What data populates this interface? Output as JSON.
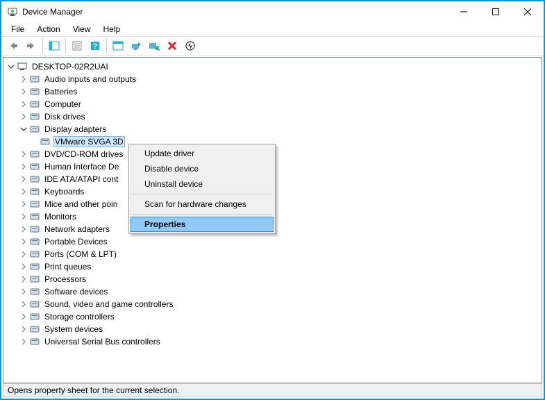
{
  "window": {
    "title": "Device Manager"
  },
  "menubar": {
    "file": "File",
    "action": "Action",
    "view": "View",
    "help": "Help"
  },
  "toolbar_icons": {
    "back": "back-arrow",
    "forward": "forward-arrow",
    "show_hide": "show-hide-console",
    "help": "help",
    "properties": "properties",
    "scan": "scan-hardware",
    "update": "update-driver",
    "uninstall": "uninstall-device",
    "disable": "disable-device"
  },
  "tree": {
    "root": "DESKTOP-02R2UAI",
    "categories": [
      {
        "label": "Audio inputs and outputs",
        "expanded": false
      },
      {
        "label": "Batteries",
        "expanded": false
      },
      {
        "label": "Computer",
        "expanded": false
      },
      {
        "label": "Disk drives",
        "expanded": false
      },
      {
        "label": "Display adapters",
        "expanded": true,
        "children": [
          {
            "label": "VMware SVGA 3D",
            "selected": true
          }
        ]
      },
      {
        "label": "DVD/CD-ROM drives",
        "expanded": false
      },
      {
        "label": "Human Interface Devices",
        "expanded": false,
        "truncated": "Human Interface De"
      },
      {
        "label": "IDE ATA/ATAPI controllers",
        "expanded": false,
        "truncated": "IDE ATA/ATAPI cont"
      },
      {
        "label": "Keyboards",
        "expanded": false
      },
      {
        "label": "Mice and other pointing devices",
        "expanded": false,
        "truncated": "Mice and other poin"
      },
      {
        "label": "Monitors",
        "expanded": false
      },
      {
        "label": "Network adapters",
        "expanded": false
      },
      {
        "label": "Portable Devices",
        "expanded": false
      },
      {
        "label": "Ports (COM & LPT)",
        "expanded": false
      },
      {
        "label": "Print queues",
        "expanded": false
      },
      {
        "label": "Processors",
        "expanded": false
      },
      {
        "label": "Software devices",
        "expanded": false
      },
      {
        "label": "Sound, video and game controllers",
        "expanded": false
      },
      {
        "label": "Storage controllers",
        "expanded": false
      },
      {
        "label": "System devices",
        "expanded": false
      },
      {
        "label": "Universal Serial Bus controllers",
        "expanded": false
      }
    ]
  },
  "context_menu": {
    "items": [
      {
        "label": "Update driver"
      },
      {
        "label": "Disable device"
      },
      {
        "label": "Uninstall device"
      },
      {
        "sep": true
      },
      {
        "label": "Scan for hardware changes"
      },
      {
        "sep": true
      },
      {
        "label": "Properties",
        "highlight": true
      }
    ]
  },
  "statusbar": {
    "text": "Opens property sheet for the current selection."
  }
}
